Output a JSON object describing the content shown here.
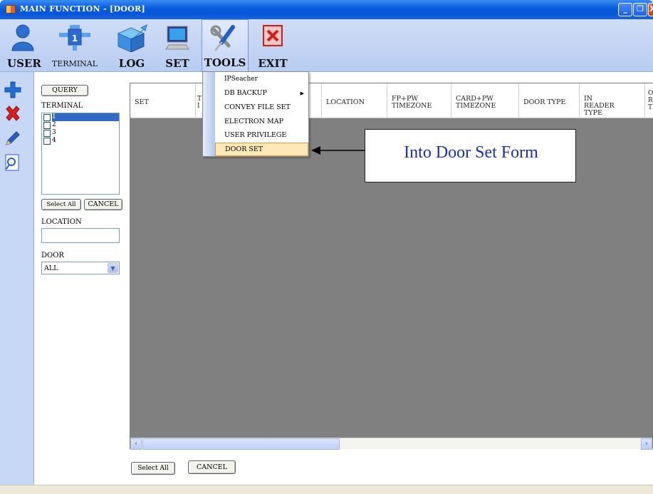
{
  "window": {
    "title": "MAIN FUNCTION - [DOOR]",
    "min_glyph": "_",
    "max_glyph": "❐",
    "close_glyph": "X"
  },
  "toolbar": {
    "items": [
      {
        "label": "USER",
        "icon": "user-icon"
      },
      {
        "label": "TERMINAL",
        "icon": "terminal-icon"
      },
      {
        "label": "LOG",
        "icon": "log-icon"
      },
      {
        "label": "SET",
        "icon": "monitor-icon"
      },
      {
        "label": "TOOLS",
        "icon": "tools-icon"
      },
      {
        "label": "EXIT",
        "icon": "exit-icon"
      }
    ]
  },
  "side_icons": [
    "add-icon",
    "delete-icon",
    "edit-icon",
    "search-icon"
  ],
  "filter": {
    "query_label": "QUERY",
    "terminal_label": "TERMINAL",
    "terminals": [
      "1",
      "2",
      "3",
      "4"
    ],
    "selected_terminal": "1",
    "select_all_label": "Select All",
    "cancel_label": "CANCEL",
    "location_label": "LOCATION",
    "location_value": "",
    "door_label": "DOOR",
    "door_value": "ALL"
  },
  "grid": {
    "columns": [
      "SET",
      "T I",
      "",
      "LOCATION",
      "FP+PW TIMEZONE",
      "CARD+PW TIMEZONE",
      "DOOR TYPE",
      "IN READER TYPE",
      "O R T"
    ],
    "rows": []
  },
  "bottom": {
    "select_all_label": "Select All",
    "cancel_label": "CANCEL"
  },
  "tools_menu": {
    "items": [
      {
        "label": "IPSeacher",
        "has_submenu": false
      },
      {
        "label": "DB BACKUP",
        "has_submenu": true
      },
      {
        "label": "CONVEY FILE SET",
        "has_submenu": false
      },
      {
        "label": "ELECTRON MAP",
        "has_submenu": false
      },
      {
        "label": "USER PRIVILEGE",
        "has_submenu": false
      },
      {
        "label": "DOOR SET",
        "has_submenu": false
      }
    ],
    "highlighted": "DOOR SET"
  },
  "callout": {
    "text": "Into Door Set Form"
  },
  "colors": {
    "titlebar": "#0a5ee0",
    "menu_highlight": "#fde9b8",
    "selection": "#316ac5",
    "callout_text": "#1a2ec0",
    "grid_background": "#808080"
  }
}
